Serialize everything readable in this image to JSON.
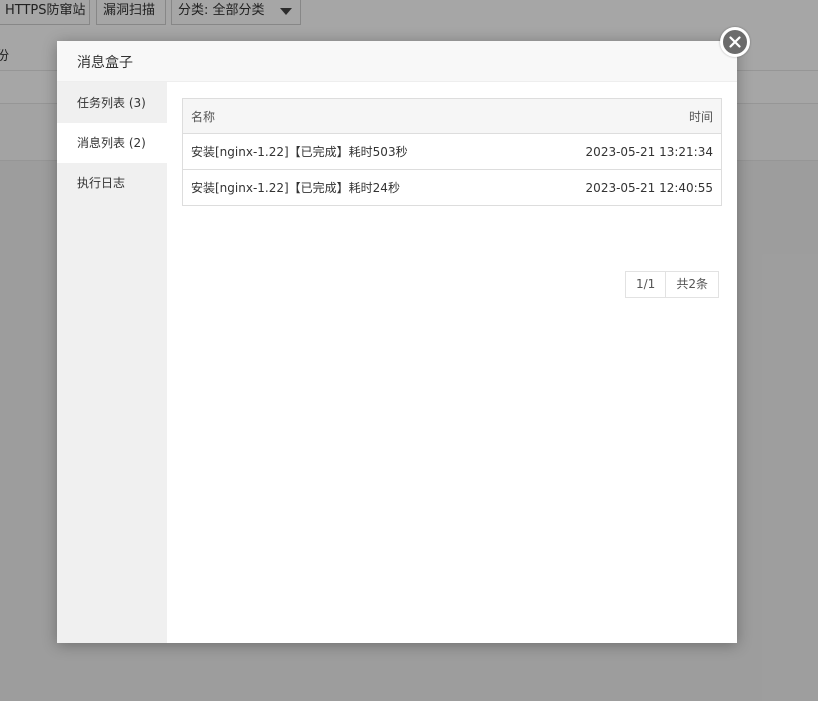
{
  "background": {
    "toolbar": {
      "https_btn": "HTTPS防窜站",
      "scan_btn": "漏洞扫描",
      "category_select": "分类: 全部分类"
    },
    "row1_text": "份"
  },
  "dialog": {
    "title": "消息盒子",
    "close_icon": "close-icon",
    "sidebar": [
      {
        "label": "任务列表 (3)",
        "active": false
      },
      {
        "label": "消息列表 (2)",
        "active": true
      },
      {
        "label": "执行日志",
        "active": false
      }
    ],
    "table": {
      "headers": {
        "name": "名称",
        "time": "时间"
      },
      "rows": [
        {
          "name": "安装[nginx-1.22]【已完成】耗时503秒",
          "time": "2023-05-21 13:21:34"
        },
        {
          "name": "安装[nginx-1.22]【已完成】耗时24秒",
          "time": "2023-05-21 12:40:55"
        }
      ]
    },
    "pager": {
      "page": "1/1",
      "total": "共2条"
    }
  },
  "colors": {
    "overlay": "#000000",
    "sidebar_bg": "#f0f0f0",
    "close_bg": "#6b6b6b"
  }
}
